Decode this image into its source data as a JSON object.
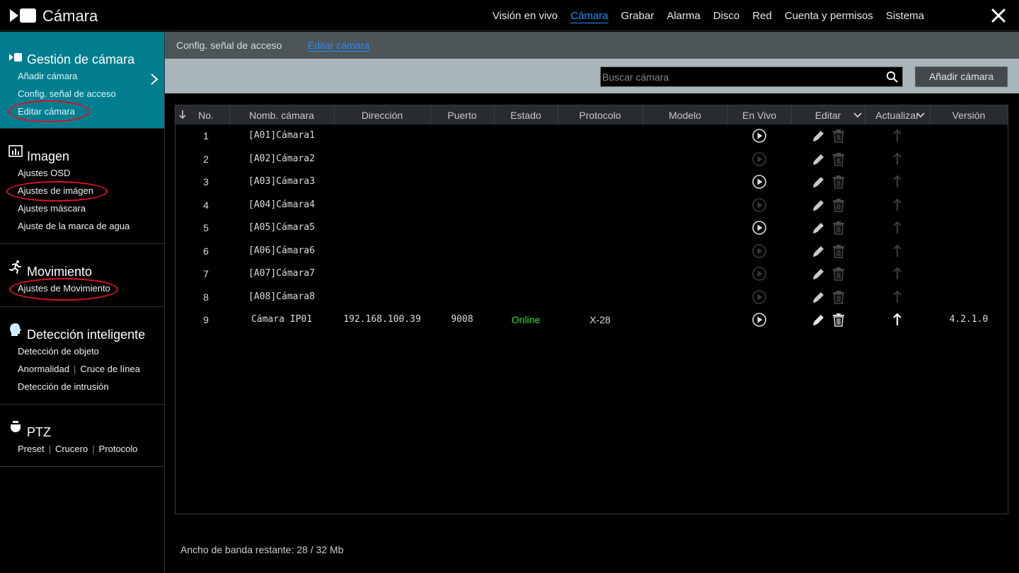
{
  "app": {
    "title": "Cámara"
  },
  "topnav": [
    {
      "label": "Visión en vivo",
      "active": false
    },
    {
      "label": "Cámara",
      "active": true
    },
    {
      "label": "Grabar",
      "active": false
    },
    {
      "label": "Alarma",
      "active": false
    },
    {
      "label": "Disco",
      "active": false
    },
    {
      "label": "Red",
      "active": false
    },
    {
      "label": "Cuenta y permisos",
      "active": false
    },
    {
      "label": "Sistema",
      "active": false
    }
  ],
  "sidebar": {
    "camera": {
      "title": "Gestión de cámara",
      "items": [
        "Añadir cámara",
        "Config. señal de acceso",
        "Editar cámara"
      ]
    },
    "image": {
      "title": "Imagen",
      "items": [
        "Ajustes OSD",
        "Ajustes de imágen",
        "Ajustes máscara",
        "Ajuste de la marca de agua"
      ]
    },
    "motion": {
      "title": "Movimiento",
      "items": [
        "Ajustes de Movimiento"
      ]
    },
    "detection": {
      "title": "Detección inteligente",
      "items": [
        "Detección de objeto",
        "Anormalidad",
        "Cruce de línea",
        "Detección de intrusión"
      ]
    },
    "ptz": {
      "title": "PTZ",
      "items": [
        "Preset",
        "Crucero",
        "Protocolo"
      ]
    }
  },
  "subtabs": [
    {
      "label": "Config. señal de acceso",
      "active": false
    },
    {
      "label": "Editar cámara",
      "active": true
    }
  ],
  "toolbar": {
    "search_placeholder": "Buscar cámara",
    "add_label": "Añadir cámara"
  },
  "table": {
    "columns": [
      "No.",
      "Nomb. cámara",
      "Dirección",
      "Puerto",
      "Estado",
      "Protocolo",
      "Modelo",
      "En Vivo",
      "Editar",
      "Actualizar",
      "Versión"
    ],
    "rows": [
      {
        "no": "1",
        "name": "[A01]Cámara1",
        "address": "",
        "port": "",
        "status": "",
        "protocol": "",
        "model": "",
        "live": true,
        "version": "",
        "enabled": false
      },
      {
        "no": "2",
        "name": "[A02]Cámara2",
        "address": "",
        "port": "",
        "status": "",
        "protocol": "",
        "model": "",
        "live": false,
        "version": "",
        "enabled": false
      },
      {
        "no": "3",
        "name": "[A03]Cámara3",
        "address": "",
        "port": "",
        "status": "",
        "protocol": "",
        "model": "",
        "live": true,
        "version": "",
        "enabled": false
      },
      {
        "no": "4",
        "name": "[A04]Cámara4",
        "address": "",
        "port": "",
        "status": "",
        "protocol": "",
        "model": "",
        "live": false,
        "version": "",
        "enabled": false
      },
      {
        "no": "5",
        "name": "[A05]Cámara5",
        "address": "",
        "port": "",
        "status": "",
        "protocol": "",
        "model": "",
        "live": true,
        "version": "",
        "enabled": false
      },
      {
        "no": "6",
        "name": "[A06]Cámara6",
        "address": "",
        "port": "",
        "status": "",
        "protocol": "",
        "model": "",
        "live": false,
        "version": "",
        "enabled": false
      },
      {
        "no": "7",
        "name": "[A07]Cámara7",
        "address": "",
        "port": "",
        "status": "",
        "protocol": "",
        "model": "",
        "live": false,
        "version": "",
        "enabled": false
      },
      {
        "no": "8",
        "name": "[A08]Cámara8",
        "address": "",
        "port": "",
        "status": "",
        "protocol": "",
        "model": "",
        "live": false,
        "version": "",
        "enabled": false
      },
      {
        "no": "9",
        "name": "Cámara IP01",
        "address": "192.168.100.39",
        "port": "9008",
        "status": "Online",
        "protocol": "X-28",
        "model": "",
        "live": true,
        "version": "4.2.1.0",
        "enabled": true
      }
    ]
  },
  "footer": {
    "bandwidth": "Ancho de banda restante: 28 / 32 Mb"
  },
  "colors": {
    "accent": "#1e90ff",
    "sidebar_active": "#007e8f",
    "online": "#2ee02e",
    "annotation": "#e0102a"
  }
}
